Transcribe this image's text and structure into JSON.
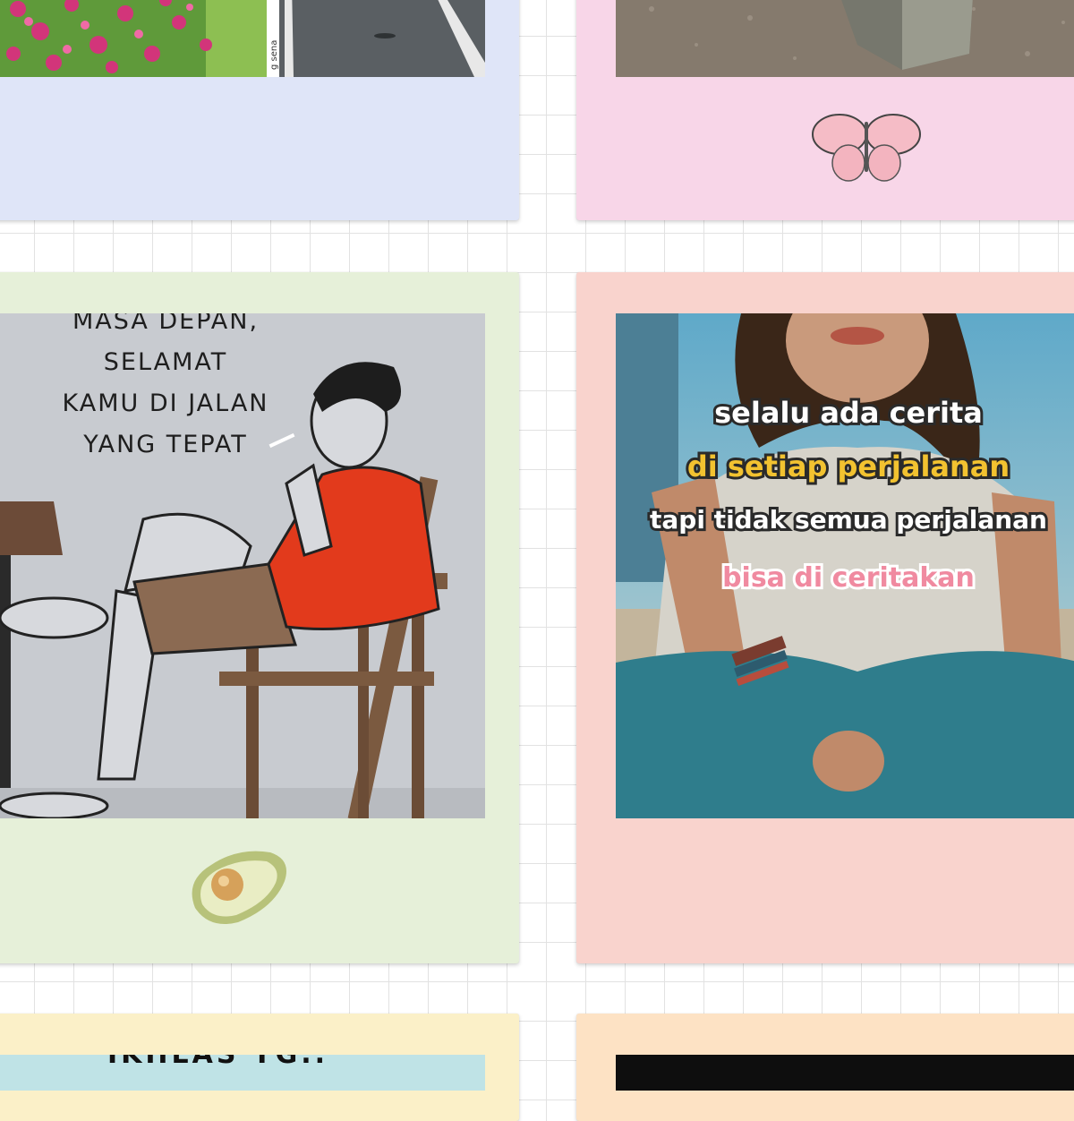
{
  "cards": {
    "top_left": {
      "bg": "#dfe5f8",
      "watermark": "g sena"
    },
    "top_right": {
      "bg": "#f8d6e8",
      "sticker": "butterfly-icon"
    },
    "mid_left": {
      "bg": "#e6f0d9",
      "sticker": "avocado-icon",
      "comic_lines": [
        "MASA DEPAN,",
        "SELAMAT",
        "KAMU DI JALAN",
        "YANG TEPAT"
      ]
    },
    "mid_right": {
      "bg": "#f9d3cd",
      "quote_lines": [
        {
          "text": "selalu ada cerita",
          "color": "#ffffff"
        },
        {
          "text": "di setiap perjalanan",
          "color": "#f2c230"
        },
        {
          "text": "tapi tidak semua perjalanan",
          "color": "#ffffff"
        },
        {
          "text": "bisa di ceritakan",
          "color": "#f08aa0"
        }
      ]
    },
    "bottom_left": {
      "bg": "#fbf0c8",
      "caption": "IKHLAS YG.."
    },
    "bottom_right": {
      "bg": "#fde2c4"
    }
  }
}
